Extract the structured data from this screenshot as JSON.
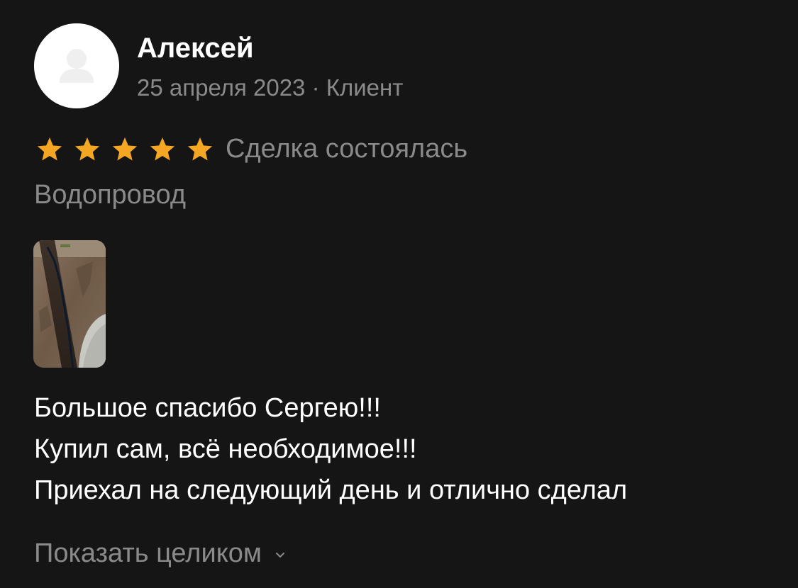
{
  "review": {
    "author": {
      "name": "Алексей",
      "avatar_icon": "user-silhouette-icon"
    },
    "meta": "25 апреля 2023 · Клиент",
    "rating": {
      "stars": 5,
      "max": 5,
      "star_color": "#F5A623"
    },
    "deal_status": "Сделка состоялась",
    "service": "Водопровод",
    "photos_count": 1,
    "text_lines": [
      "Большое спасибо Сергею!!!",
      "Купил сам, всё необходимое!!!",
      "Приехал на следующий день и отлично сделал"
    ],
    "show_more": {
      "label": "Показать целиком",
      "icon": "chevron-down-icon"
    }
  },
  "colors": {
    "background": "#151515",
    "primary_text": "#FFFFFF",
    "secondary_text": "#8A8A8A"
  }
}
